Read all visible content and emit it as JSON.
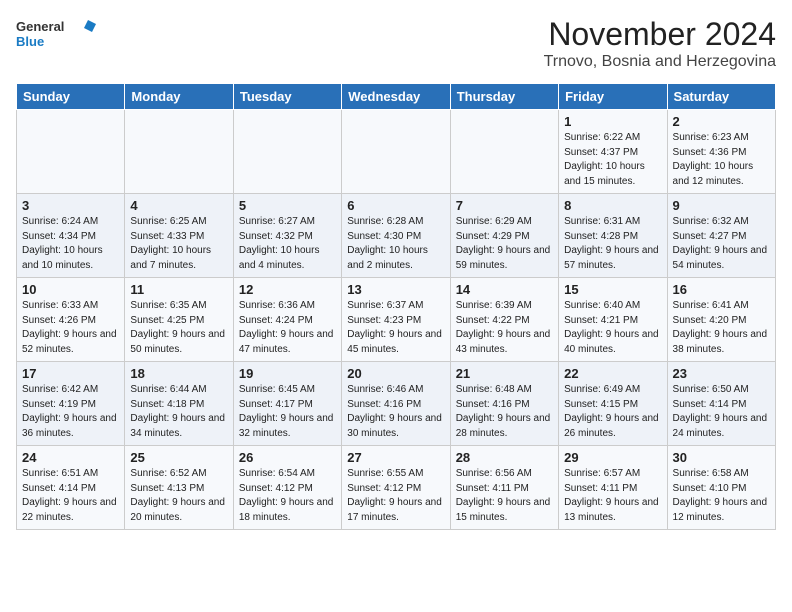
{
  "header": {
    "logo": {
      "general": "General",
      "blue": "Blue"
    },
    "title": "November 2024",
    "subtitle": "Trnovo, Bosnia and Herzegovina"
  },
  "days": [
    "Sunday",
    "Monday",
    "Tuesday",
    "Wednesday",
    "Thursday",
    "Friday",
    "Saturday"
  ],
  "weeks": [
    [
      {
        "date": "",
        "info": ""
      },
      {
        "date": "",
        "info": ""
      },
      {
        "date": "",
        "info": ""
      },
      {
        "date": "",
        "info": ""
      },
      {
        "date": "",
        "info": ""
      },
      {
        "date": "1",
        "info": "Sunrise: 6:22 AM\nSunset: 4:37 PM\nDaylight: 10 hours and 15 minutes."
      },
      {
        "date": "2",
        "info": "Sunrise: 6:23 AM\nSunset: 4:36 PM\nDaylight: 10 hours and 12 minutes."
      }
    ],
    [
      {
        "date": "3",
        "info": "Sunrise: 6:24 AM\nSunset: 4:34 PM\nDaylight: 10 hours and 10 minutes."
      },
      {
        "date": "4",
        "info": "Sunrise: 6:25 AM\nSunset: 4:33 PM\nDaylight: 10 hours and 7 minutes."
      },
      {
        "date": "5",
        "info": "Sunrise: 6:27 AM\nSunset: 4:32 PM\nDaylight: 10 hours and 4 minutes."
      },
      {
        "date": "6",
        "info": "Sunrise: 6:28 AM\nSunset: 4:30 PM\nDaylight: 10 hours and 2 minutes."
      },
      {
        "date": "7",
        "info": "Sunrise: 6:29 AM\nSunset: 4:29 PM\nDaylight: 9 hours and 59 minutes."
      },
      {
        "date": "8",
        "info": "Sunrise: 6:31 AM\nSunset: 4:28 PM\nDaylight: 9 hours and 57 minutes."
      },
      {
        "date": "9",
        "info": "Sunrise: 6:32 AM\nSunset: 4:27 PM\nDaylight: 9 hours and 54 minutes."
      }
    ],
    [
      {
        "date": "10",
        "info": "Sunrise: 6:33 AM\nSunset: 4:26 PM\nDaylight: 9 hours and 52 minutes."
      },
      {
        "date": "11",
        "info": "Sunrise: 6:35 AM\nSunset: 4:25 PM\nDaylight: 9 hours and 50 minutes."
      },
      {
        "date": "12",
        "info": "Sunrise: 6:36 AM\nSunset: 4:24 PM\nDaylight: 9 hours and 47 minutes."
      },
      {
        "date": "13",
        "info": "Sunrise: 6:37 AM\nSunset: 4:23 PM\nDaylight: 9 hours and 45 minutes."
      },
      {
        "date": "14",
        "info": "Sunrise: 6:39 AM\nSunset: 4:22 PM\nDaylight: 9 hours and 43 minutes."
      },
      {
        "date": "15",
        "info": "Sunrise: 6:40 AM\nSunset: 4:21 PM\nDaylight: 9 hours and 40 minutes."
      },
      {
        "date": "16",
        "info": "Sunrise: 6:41 AM\nSunset: 4:20 PM\nDaylight: 9 hours and 38 minutes."
      }
    ],
    [
      {
        "date": "17",
        "info": "Sunrise: 6:42 AM\nSunset: 4:19 PM\nDaylight: 9 hours and 36 minutes."
      },
      {
        "date": "18",
        "info": "Sunrise: 6:44 AM\nSunset: 4:18 PM\nDaylight: 9 hours and 34 minutes."
      },
      {
        "date": "19",
        "info": "Sunrise: 6:45 AM\nSunset: 4:17 PM\nDaylight: 9 hours and 32 minutes."
      },
      {
        "date": "20",
        "info": "Sunrise: 6:46 AM\nSunset: 4:16 PM\nDaylight: 9 hours and 30 minutes."
      },
      {
        "date": "21",
        "info": "Sunrise: 6:48 AM\nSunset: 4:16 PM\nDaylight: 9 hours and 28 minutes."
      },
      {
        "date": "22",
        "info": "Sunrise: 6:49 AM\nSunset: 4:15 PM\nDaylight: 9 hours and 26 minutes."
      },
      {
        "date": "23",
        "info": "Sunrise: 6:50 AM\nSunset: 4:14 PM\nDaylight: 9 hours and 24 minutes."
      }
    ],
    [
      {
        "date": "24",
        "info": "Sunrise: 6:51 AM\nSunset: 4:14 PM\nDaylight: 9 hours and 22 minutes."
      },
      {
        "date": "25",
        "info": "Sunrise: 6:52 AM\nSunset: 4:13 PM\nDaylight: 9 hours and 20 minutes."
      },
      {
        "date": "26",
        "info": "Sunrise: 6:54 AM\nSunset: 4:12 PM\nDaylight: 9 hours and 18 minutes."
      },
      {
        "date": "27",
        "info": "Sunrise: 6:55 AM\nSunset: 4:12 PM\nDaylight: 9 hours and 17 minutes."
      },
      {
        "date": "28",
        "info": "Sunrise: 6:56 AM\nSunset: 4:11 PM\nDaylight: 9 hours and 15 minutes."
      },
      {
        "date": "29",
        "info": "Sunrise: 6:57 AM\nSunset: 4:11 PM\nDaylight: 9 hours and 13 minutes."
      },
      {
        "date": "30",
        "info": "Sunrise: 6:58 AM\nSunset: 4:10 PM\nDaylight: 9 hours and 12 minutes."
      }
    ]
  ]
}
